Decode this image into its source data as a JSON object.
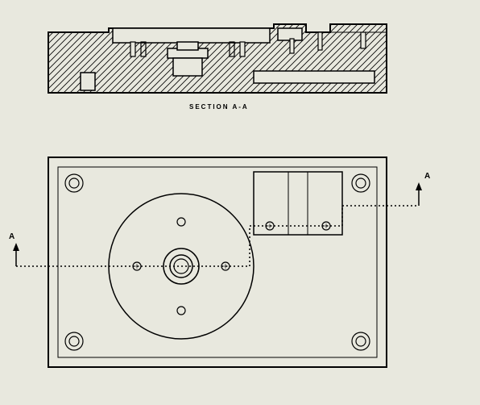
{
  "drawing": {
    "section_label": "SECTION A-A",
    "section_marker_left": "A",
    "section_marker_right": "A",
    "views": {
      "section": {
        "description": "Cross section A-A of machined plate fixture with crosshatched material, internal cavities, posts and counterbored holes"
      },
      "top": {
        "description": "Top view of rectangular base plate with four corner mounting holes (counterbored), large central circular boss with concentric bore and four small bolt circle holes, and rectangular raised pad with two mounting holes on upper right",
        "corner_holes_count": 4,
        "central_boss": {
          "has_outer_circle": true,
          "has_inner_bore": true,
          "bolt_circle_holes": 4
        },
        "rect_pad": {
          "holes": 2
        }
      }
    }
  }
}
